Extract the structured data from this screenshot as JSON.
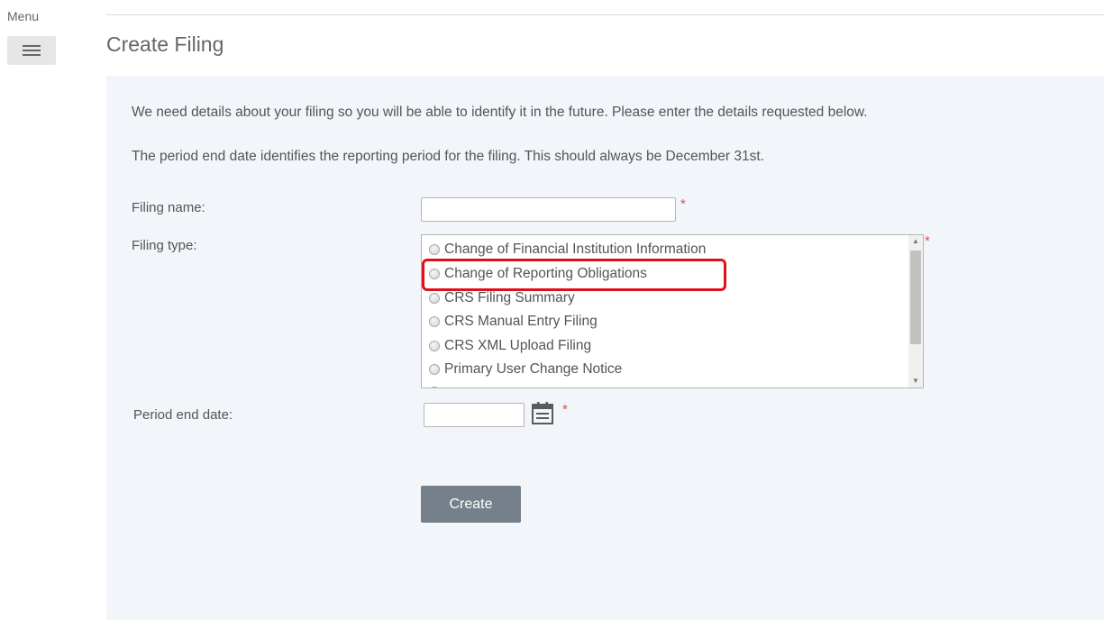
{
  "menu": {
    "label": "Menu",
    "icon": "hamburger-icon"
  },
  "page": {
    "title": "Create Filing"
  },
  "intro": {
    "line1": "We need details about your filing so you will be able to identify it in the future. Please enter the details requested below.",
    "line2": "The period end date identifies the reporting period for the filing. This should always be December 31st."
  },
  "form": {
    "filing_name": {
      "label": "Filing name:",
      "value": "",
      "required_mark": "*"
    },
    "filing_type": {
      "label": "Filing type:",
      "required_mark": "*",
      "options": [
        "Change of Financial Institution Information",
        "Change of Reporting Obligations",
        "CRS Filing Summary",
        "CRS Manual Entry Filing",
        "CRS XML Upload Filing",
        "Primary User Change Notice"
      ],
      "highlighted_option": "Change of Reporting Obligations"
    },
    "period_end_date": {
      "label": "Period end date:",
      "value": "",
      "required_mark": "*",
      "icon": "calendar-icon"
    },
    "create_button": "Create"
  },
  "colors": {
    "panel_bg": "#f2f5fa",
    "required": "#d9534f",
    "button_bg": "#75808a",
    "highlight": "#e0101b"
  }
}
